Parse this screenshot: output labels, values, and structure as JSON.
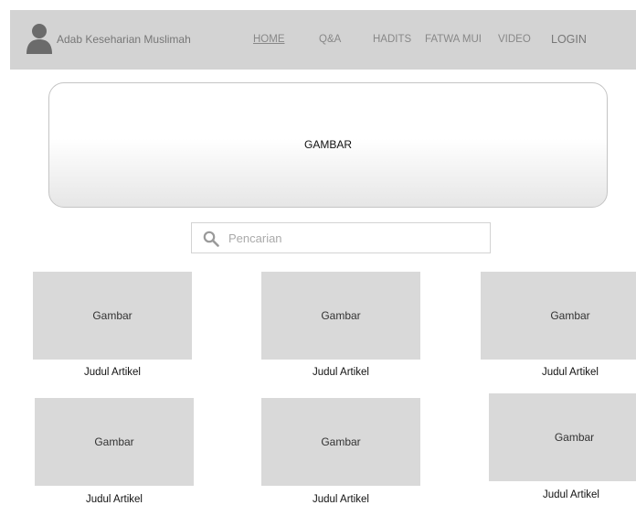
{
  "navbar": {
    "brand": "Adab Keseharian Muslimah",
    "links": [
      "HOME",
      "Q&A",
      "HADITS",
      "FATWA MUI",
      "VIDEO"
    ],
    "login": "LOGIN"
  },
  "hero": {
    "label": "GAMBAR"
  },
  "search": {
    "placeholder": "Pencarian"
  },
  "articles": [
    {
      "image_label": "Gambar",
      "title": "Judul Artikel"
    },
    {
      "image_label": "Gambar",
      "title": "Judul Artikel"
    },
    {
      "image_label": "Gambar",
      "title": "Judul Artikel"
    },
    {
      "image_label": "Gambar",
      "title": "Judul Artikel"
    },
    {
      "image_label": "Gambar",
      "title": "Judul Artikel"
    },
    {
      "image_label": "Gambar",
      "title": "Judul Artikel"
    }
  ]
}
